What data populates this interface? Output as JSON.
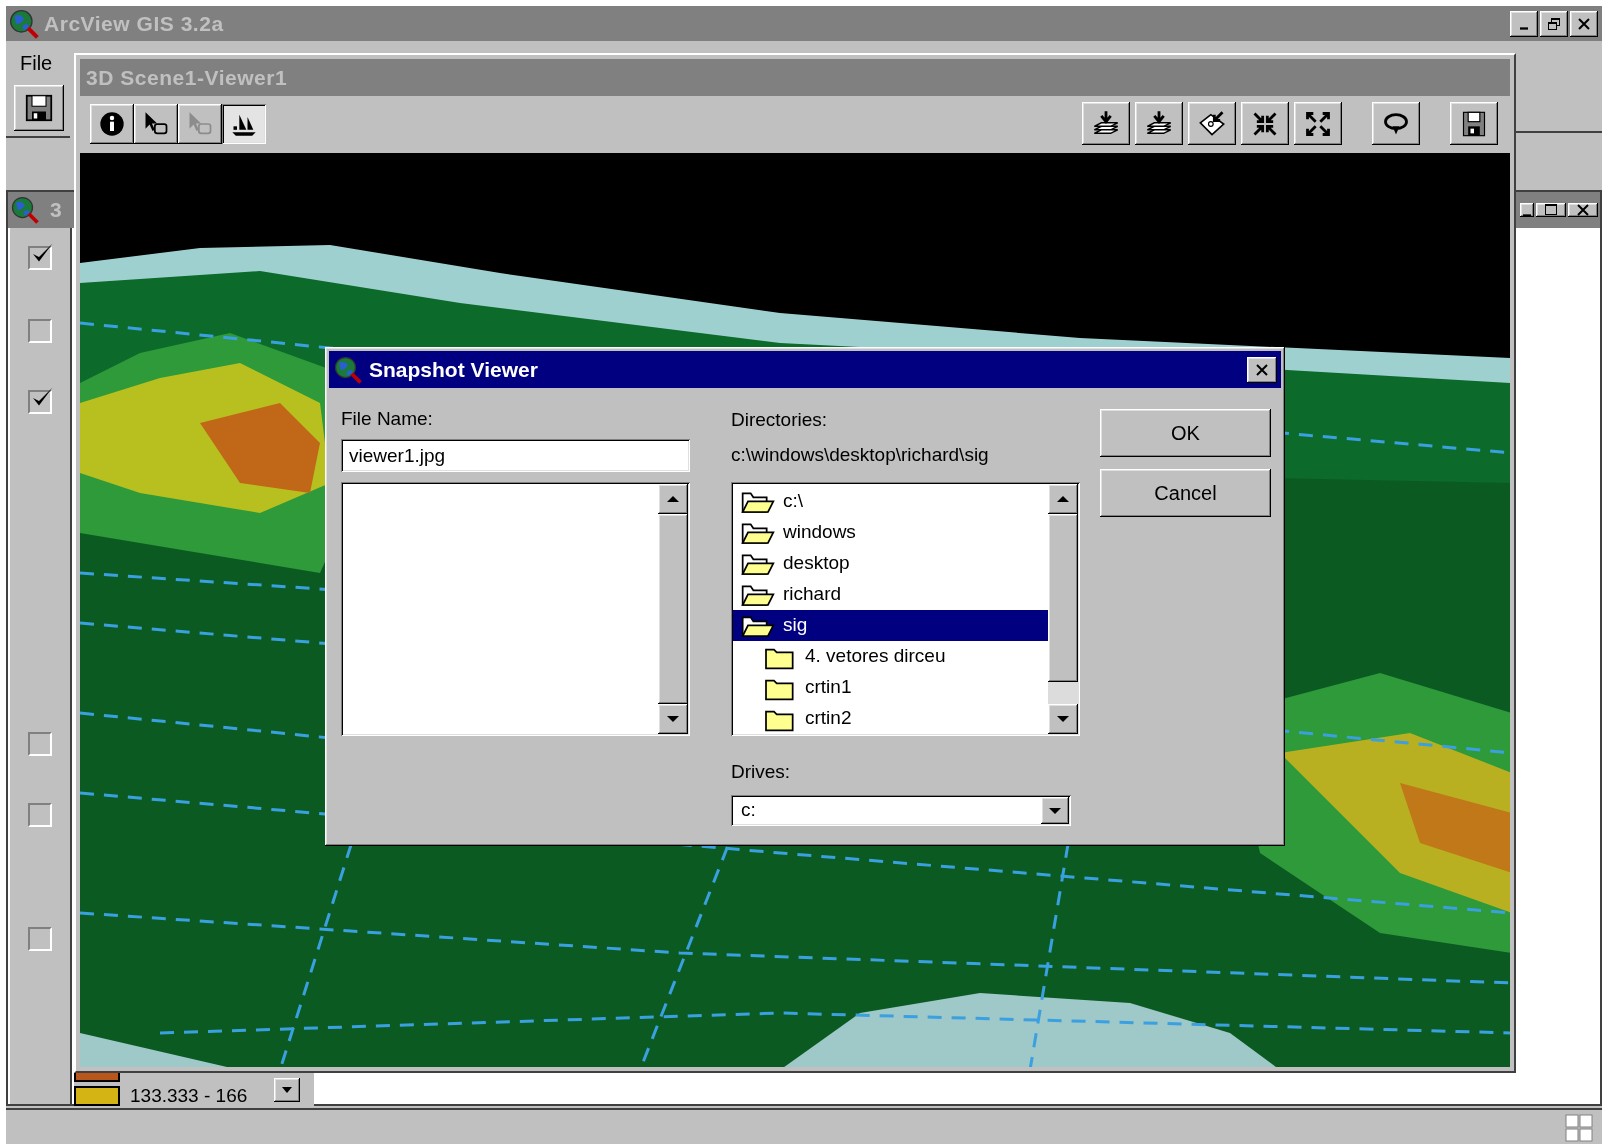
{
  "app": {
    "title": "ArcView GIS 3.2a",
    "menu": [
      {
        "label": "File"
      }
    ]
  },
  "background_window": {
    "title": "3",
    "layers": [
      {
        "visible": true
      },
      {
        "visible": false
      },
      {
        "visible": true
      },
      {
        "visible": false
      },
      {
        "visible": false
      },
      {
        "visible": false
      }
    ],
    "legend": [
      {
        "color": "#b8561c"
      },
      {
        "color": "#d4b414",
        "label": "133.333 - 166"
      }
    ]
  },
  "viewer": {
    "title": "3D Scene1-Viewer1",
    "left_tools": [
      {
        "kind": "info",
        "selected": false,
        "disabled": false
      },
      {
        "kind": "pointer",
        "selected": false,
        "disabled": false
      },
      {
        "kind": "pointer",
        "selected": false,
        "disabled": true
      },
      {
        "kind": "boat",
        "selected": true,
        "disabled": false
      }
    ],
    "right_tools": [
      {
        "kind": "layers"
      },
      {
        "kind": "layers"
      },
      {
        "kind": "diamond"
      },
      {
        "kind": "collapse"
      },
      {
        "kind": "expand"
      },
      {
        "kind": "loop"
      },
      {
        "kind": "floppy"
      }
    ]
  },
  "dialog": {
    "title": "Snapshot Viewer",
    "file_name_label": "File Name:",
    "file_name": "viewer1.jpg",
    "directories_label": "Directories:",
    "current_path": "c:\\windows\\desktop\\richard\\sig",
    "directories": [
      {
        "label": "c:\\",
        "open": true,
        "selected": false
      },
      {
        "label": "windows",
        "open": true,
        "selected": false
      },
      {
        "label": "desktop",
        "open": true,
        "selected": false
      },
      {
        "label": "richard",
        "open": true,
        "selected": false
      },
      {
        "label": "sig",
        "open": true,
        "selected": true,
        "children": [
          {
            "label": "4. vetores dirceu",
            "open": false,
            "selected": false
          },
          {
            "label": "crtin1",
            "open": false,
            "selected": false
          },
          {
            "label": "crtin2",
            "open": false,
            "selected": false
          }
        ]
      }
    ],
    "drives_label": "Drives:",
    "drive": "c:",
    "buttons": [
      {
        "label": "OK"
      },
      {
        "label": "Cancel"
      }
    ]
  }
}
